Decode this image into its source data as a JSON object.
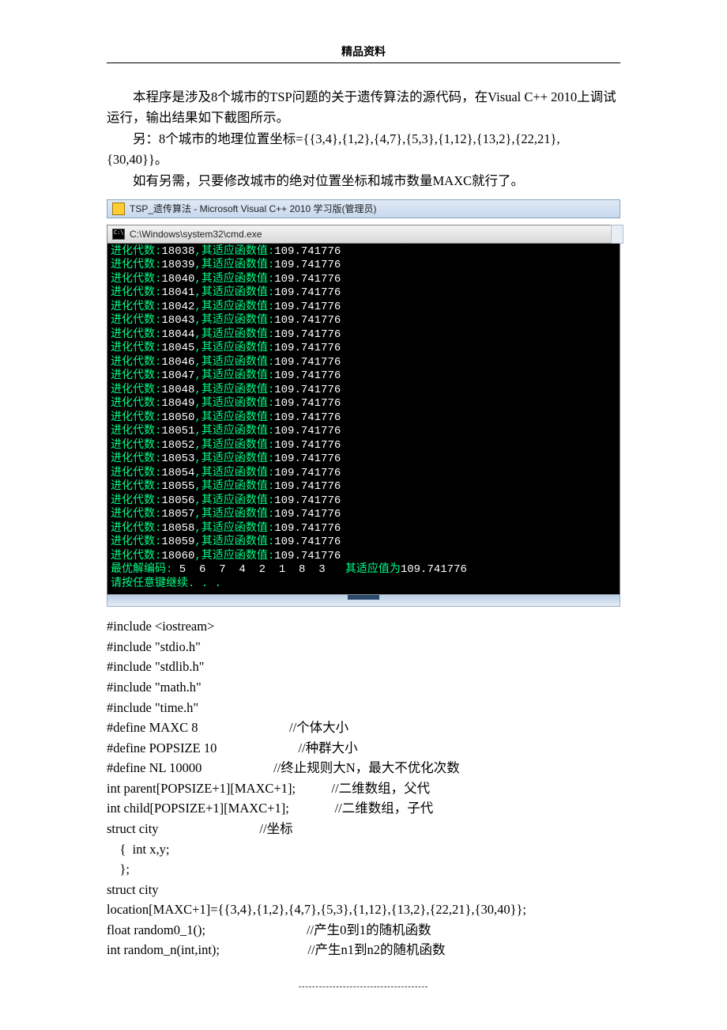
{
  "header": {
    "title": "精品资料"
  },
  "intro": {
    "p1": "本程序是涉及8个城市的TSP问题的关于遗传算法的源代码，在Visual C++ 2010上调试运行，输出结果如下截图所示。",
    "p2": "另：8个城市的地理位置坐标={{3,4},{1,2},{4,7},{5,3},{1,12},{13,2},{22,21},{30,40}}。",
    "p3": "如有另需，只要修改城市的绝对位置坐标和城市数量MAXC就行了。"
  },
  "vs_window": {
    "title": "TSP_遗传算法 - Microsoft Visual C++ 2010 学习版(管理员)"
  },
  "cmd_window": {
    "title": "C:\\Windows\\system32\\cmd.exe"
  },
  "console": {
    "prefix": "进化代数:",
    "mid": ",其适应函数值:",
    "fitness": "109.741776",
    "gens": [
      "18038",
      "18039",
      "18040",
      "18041",
      "18042",
      "18043",
      "18044",
      "18045",
      "18046",
      "18047",
      "18048",
      "18049",
      "18050",
      "18051",
      "18052",
      "18053",
      "18054",
      "18055",
      "18056",
      "18057",
      "18058",
      "18059",
      "18060"
    ],
    "best_label": "最优解编码:",
    "best_seq": " 5  6  7  4  2  1  8  3   ",
    "best_suffix_label": "其适应值为",
    "best_suffix_value": "109.741776",
    "press_any": "请按任意键继续. . ."
  },
  "code": {
    "lines": [
      "#include <iostream>",
      "#include \"stdio.h\"",
      "#include \"stdlib.h\"",
      "#include \"math.h\"",
      "#include \"time.h\"",
      "#define MAXC 8                            //个体大小",
      "#define POPSIZE 10                         //种群大小",
      "#define NL 10000                      //终止规则大N，最大不优化次数",
      "int parent[POPSIZE+1][MAXC+1];           //二维数组，父代",
      "int child[POPSIZE+1][MAXC+1];              //二维数组，子代",
      "struct city                               //坐标",
      "    {  int x,y;",
      "    };",
      "struct city",
      "location[MAXC+1]={{3,4},{1,2},{4,7},{5,3},{1,12},{13,2},{22,21},{30,40}};",
      "float random0_1();                               //产生0到1的随机函数",
      "int random_n(int,int);                           //产生n1到n2的随机函数"
    ]
  },
  "footer": {
    "dots": "--------------------------------------"
  }
}
